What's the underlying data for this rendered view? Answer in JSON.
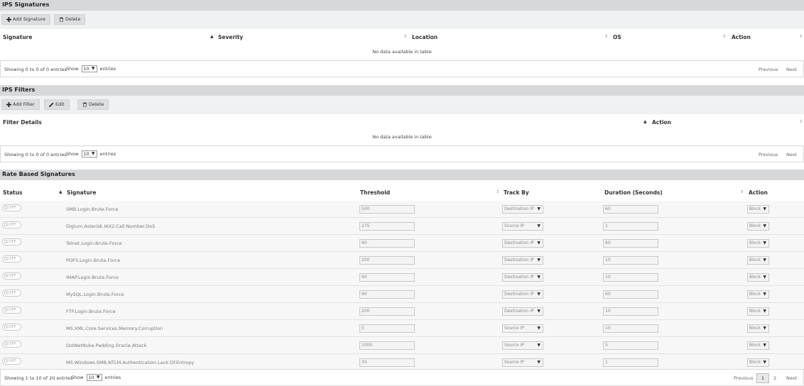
{
  "ips_signatures": {
    "title": "IPS Signatures",
    "buttons": {
      "add": "Add Signature",
      "delete": "Delete"
    },
    "columns": [
      "Signature",
      "Severity",
      "Location",
      "OS",
      "Action"
    ],
    "empty": "No data available in table",
    "footer": {
      "info": "Showing 0 to 0 of 0 entries",
      "show": "Show",
      "page_size": "10",
      "entries": "entries",
      "previous": "Previous",
      "next": "Next"
    }
  },
  "ips_filters": {
    "title": "IPS Filters",
    "buttons": {
      "add": "Add Filter",
      "edit": "Edit",
      "delete": "Delete"
    },
    "columns": [
      "Filter Details",
      "Action"
    ],
    "empty": "No data available in table",
    "footer": {
      "info": "Showing 0 to 0 of 0 entries",
      "show": "Show",
      "page_size": "10",
      "entries": "entries",
      "previous": "Previous",
      "next": "Next"
    }
  },
  "rate_based": {
    "title": "Rate Based Signatures",
    "columns": [
      "Status",
      "Signature",
      "Threshold",
      "Track By",
      "Duration (Seconds)",
      "Action"
    ],
    "rows": [
      {
        "status": "OFF",
        "signature": "SMB.Login.Brute.Force",
        "threshold": "500",
        "track_by": "Destination IP",
        "duration": "60",
        "action": "Block"
      },
      {
        "status": "OFF",
        "signature": "Digium.Asterisk.IAX2.Call.Number.DoS",
        "threshold": "275",
        "track_by": "Source IP",
        "duration": "1",
        "action": "Block"
      },
      {
        "status": "OFF",
        "signature": "Telnet.Login.Brute.Force",
        "threshold": "60",
        "track_by": "Destination IP",
        "duration": "60",
        "action": "Block"
      },
      {
        "status": "OFF",
        "signature": "POP3.Login.Brute.Force",
        "threshold": "200",
        "track_by": "Destination IP",
        "duration": "10",
        "action": "Block"
      },
      {
        "status": "OFF",
        "signature": "IMAP.Login.Brute.Force",
        "threshold": "60",
        "track_by": "Destination IP",
        "duration": "10",
        "action": "Block"
      },
      {
        "status": "OFF",
        "signature": "MySQL.Login.Brute.Force",
        "threshold": "60",
        "track_by": "Destination IP",
        "duration": "60",
        "action": "Block"
      },
      {
        "status": "OFF",
        "signature": "FTP.Login.Brute.Force",
        "threshold": "200",
        "track_by": "Destination IP",
        "duration": "10",
        "action": "Block"
      },
      {
        "status": "OFF",
        "signature": "MS.XML.Core.Services.Memory.Corruption",
        "threshold": "5",
        "track_by": "Source IP",
        "duration": "10",
        "action": "Block"
      },
      {
        "status": "OFF",
        "signature": "DotNetNuke.Padding.Oracle.Attack",
        "threshold": "1000",
        "track_by": "Source IP",
        "duration": "5",
        "action": "Block"
      },
      {
        "status": "OFF",
        "signature": "MS.Windows.SMB.NTLM.Authentication.Lack.Of.Entropy",
        "threshold": "35",
        "track_by": "Source IP",
        "duration": "1",
        "action": "Block"
      }
    ],
    "footer": {
      "info": "Showing 1 to 10 of 20 entries",
      "show": "Show",
      "page_size": "10",
      "entries": "entries",
      "previous": "Previous",
      "page1": "1",
      "page2": "2",
      "next": "Next"
    }
  }
}
